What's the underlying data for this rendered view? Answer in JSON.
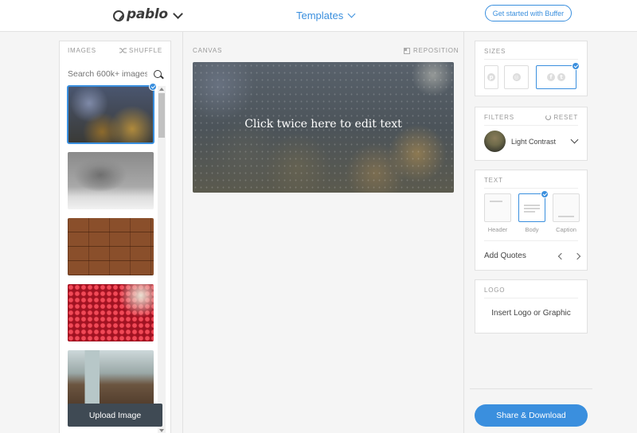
{
  "header": {
    "logo_text": "pablo",
    "templates_label": "Templates",
    "cta_label": "Get started with Buffer"
  },
  "images": {
    "title": "IMAGES",
    "shuffle_label": "SHUFFLE",
    "search_placeholder": "Search 600k+ images",
    "upload_label": "Upload Image",
    "thumbnails": [
      "rainy-window-bokeh",
      "lone-tree-snow",
      "wood-planks",
      "raspberries-bowl",
      "coffee-cup-table"
    ]
  },
  "canvas": {
    "label": "CANVAS",
    "reposition_label": "REPOSITION",
    "text": "Click twice here to edit text"
  },
  "sizes": {
    "title": "SIZES",
    "selected": "facebook-twitter"
  },
  "filters": {
    "title": "FILTERS",
    "reset_label": "RESET",
    "current": "Light Contrast"
  },
  "text_panel": {
    "title": "TEXT",
    "options": [
      "Header",
      "Body",
      "Caption"
    ],
    "selected": "Body",
    "quotes_label": "Add Quotes"
  },
  "logo_panel": {
    "title": "LOGO",
    "insert_label": "Insert Logo or Graphic"
  },
  "share": {
    "label": "Share & Download"
  },
  "colors": {
    "accent": "#3a8fde",
    "upload_bg": "#3f4a54"
  }
}
